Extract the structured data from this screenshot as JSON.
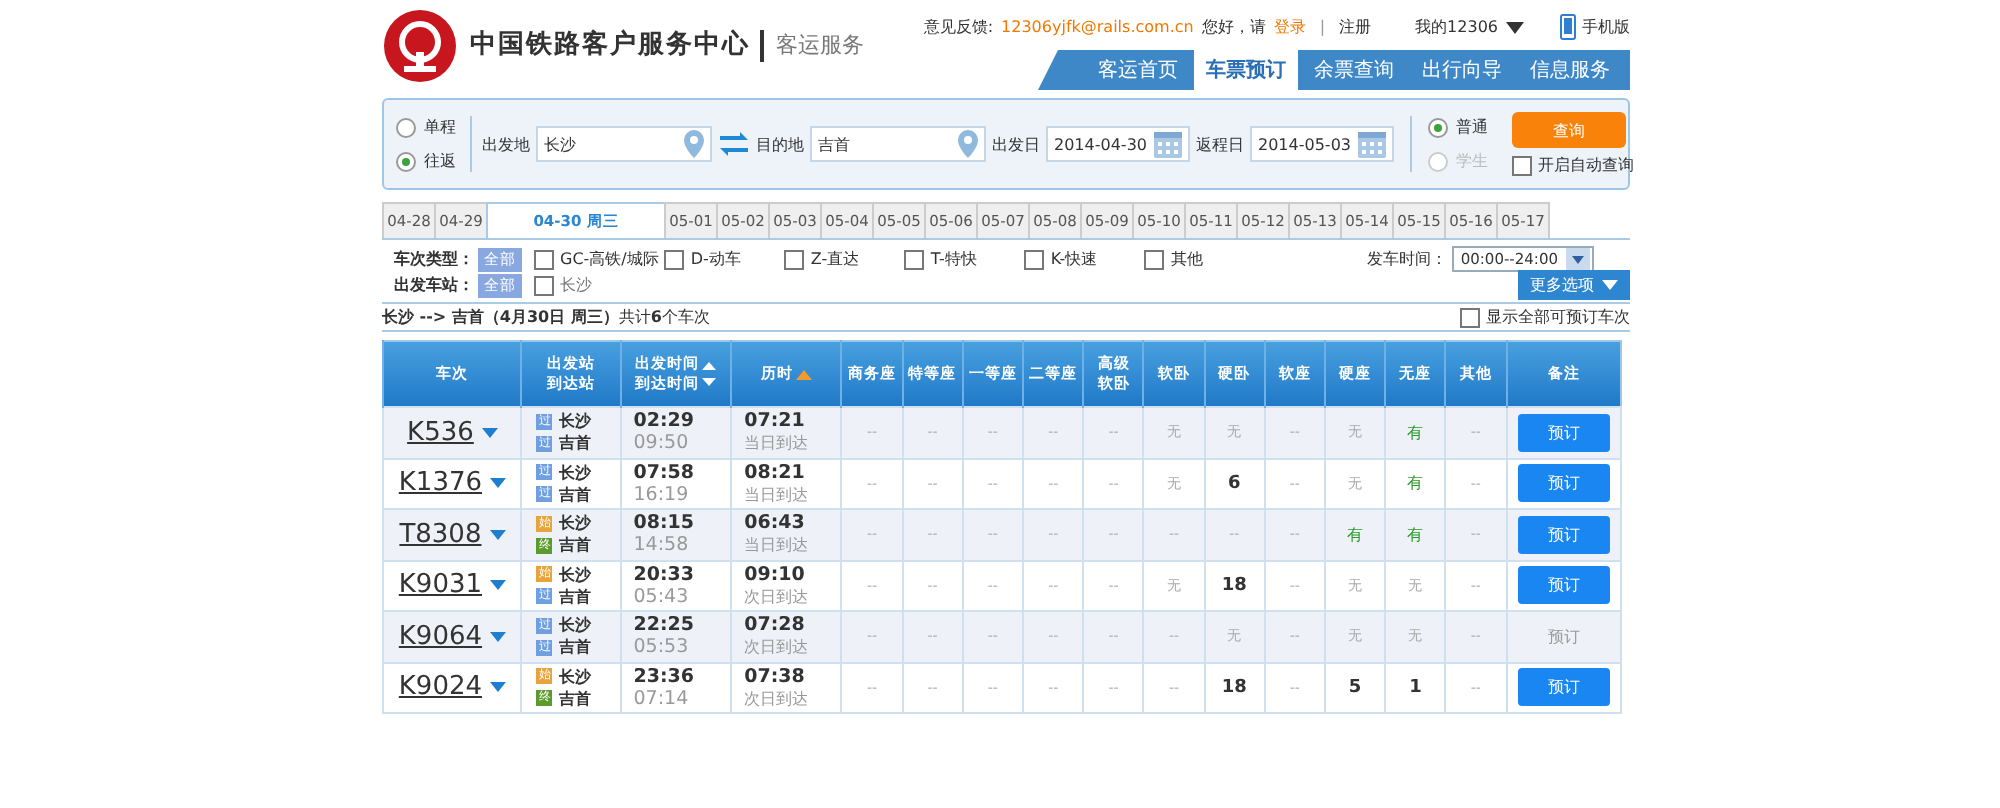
{
  "header": {
    "site_title": "中国铁路客户服务中心",
    "subtitle": "客运服务",
    "feedback_label": "意见反馈:",
    "feedback_email": "12306yjfk@rails.com.cn",
    "greeting": "您好，请",
    "login": "登录",
    "separator": "|",
    "register": "注册",
    "my_account": "我的12306",
    "mobile": "手机版"
  },
  "nav": [
    {
      "label": "客运首页",
      "selected": false
    },
    {
      "label": "车票预订",
      "selected": true
    },
    {
      "label": "余票查询",
      "selected": false
    },
    {
      "label": "出行向导",
      "selected": false
    },
    {
      "label": "信息服务",
      "selected": false
    }
  ],
  "search": {
    "trip_types": [
      {
        "label": "单程",
        "selected": false
      },
      {
        "label": "往返",
        "selected": true
      }
    ],
    "from_label": "出发地",
    "from_value": "长沙",
    "to_label": "目的地",
    "to_value": "吉首",
    "depart_label": "出发日",
    "depart_value": "2014-04-30",
    "return_label": "返程日",
    "return_value": "2014-05-03",
    "passenger_types": [
      {
        "label": "普通",
        "selected": true,
        "disabled": false
      },
      {
        "label": "学生",
        "selected": false,
        "disabled": true
      }
    ],
    "query_button": "查询",
    "auto_query": {
      "label": "开启自动查询",
      "checked": false
    }
  },
  "date_tabs": [
    {
      "label": "04-28",
      "selected": false
    },
    {
      "label": "04-29",
      "selected": false
    },
    {
      "label": "04-30 周三",
      "selected": true
    },
    {
      "label": "05-01",
      "selected": false
    },
    {
      "label": "05-02",
      "selected": false
    },
    {
      "label": "05-03",
      "selected": false
    },
    {
      "label": "05-04",
      "selected": false
    },
    {
      "label": "05-05",
      "selected": false
    },
    {
      "label": "05-06",
      "selected": false
    },
    {
      "label": "05-07",
      "selected": false
    },
    {
      "label": "05-08",
      "selected": false
    },
    {
      "label": "05-09",
      "selected": false
    },
    {
      "label": "05-10",
      "selected": false
    },
    {
      "label": "05-11",
      "selected": false
    },
    {
      "label": "05-12",
      "selected": false
    },
    {
      "label": "05-13",
      "selected": false
    },
    {
      "label": "05-14",
      "selected": false
    },
    {
      "label": "05-15",
      "selected": false
    },
    {
      "label": "05-16",
      "selected": false
    },
    {
      "label": "05-17",
      "selected": false
    }
  ],
  "filters": {
    "type_label": "车次类型：",
    "type_all": "全部",
    "types": [
      {
        "label": "GC-高铁/城际",
        "checked": false
      },
      {
        "label": "D-动车",
        "checked": false
      },
      {
        "label": "Z-直达",
        "checked": false
      },
      {
        "label": "T-特快",
        "checked": false
      },
      {
        "label": "K-快速",
        "checked": false
      },
      {
        "label": "其他",
        "checked": false
      }
    ],
    "time_label": "发车时间：",
    "time_value": "00:00--24:00",
    "station_label": "出发车站：",
    "station_all": "全部",
    "stations": [
      {
        "label": "长沙",
        "checked": false
      }
    ],
    "more_options": "更多选项"
  },
  "summary": "**长沙 --> 吉首（4月30日  周三）**共计**6**个车次",
  "show_all": {
    "label": "显示全部可预订车次",
    "checked": false
  },
  "table": {
    "columns": [
      {
        "label": "车次",
        "kind": "plain"
      },
      {
        "lines": [
          "出发站",
          "到达站"
        ],
        "kind": "plain"
      },
      {
        "lines": [
          "出发时间",
          "到达时间"
        ],
        "kind": "updown"
      },
      {
        "label": "历时",
        "kind": "up"
      },
      {
        "label": "商务座",
        "kind": "plain"
      },
      {
        "label": "特等座",
        "kind": "plain"
      },
      {
        "label": "一等座",
        "kind": "plain"
      },
      {
        "label": "二等座",
        "kind": "plain"
      },
      {
        "lines": [
          "高级",
          "软卧"
        ],
        "kind": "plain"
      },
      {
        "label": "软卧",
        "kind": "plain"
      },
      {
        "label": "硬卧",
        "kind": "plain"
      },
      {
        "label": "软座",
        "kind": "plain"
      },
      {
        "label": "硬座",
        "kind": "plain"
      },
      {
        "label": "无座",
        "kind": "plain"
      },
      {
        "label": "其他",
        "kind": "plain"
      },
      {
        "label": "备注",
        "kind": "plain"
      }
    ],
    "rows": [
      {
        "train": "K536",
        "from": {
          "badge": "过",
          "kind": "pass",
          "name": "长沙"
        },
        "to": {
          "badge": "过",
          "kind": "pass",
          "name": "吉首"
        },
        "depart": "02:29",
        "arrive": "09:50",
        "duration": "07:21",
        "arrival_day": "当日到达",
        "seats": [
          "--",
          "--",
          "--",
          "--",
          "--",
          "无",
          "无",
          "--",
          "无",
          "有",
          "--"
        ],
        "book": {
          "label": "预订",
          "disabled": false
        }
      },
      {
        "train": "K1376",
        "from": {
          "badge": "过",
          "kind": "pass",
          "name": "长沙"
        },
        "to": {
          "badge": "过",
          "kind": "pass",
          "name": "吉首"
        },
        "depart": "07:58",
        "arrive": "16:19",
        "duration": "08:21",
        "arrival_day": "当日到达",
        "seats": [
          "--",
          "--",
          "--",
          "--",
          "--",
          "无",
          "6",
          "--",
          "无",
          "有",
          "--"
        ],
        "book": {
          "label": "预订",
          "disabled": false
        }
      },
      {
        "train": "T8308",
        "from": {
          "badge": "始",
          "kind": "start",
          "name": "长沙"
        },
        "to": {
          "badge": "终",
          "kind": "end",
          "name": "吉首"
        },
        "depart": "08:15",
        "arrive": "14:58",
        "duration": "06:43",
        "arrival_day": "当日到达",
        "seats": [
          "--",
          "--",
          "--",
          "--",
          "--",
          "--",
          "--",
          "--",
          "有",
          "有",
          "--"
        ],
        "book": {
          "label": "预订",
          "disabled": false
        }
      },
      {
        "train": "K9031",
        "from": {
          "badge": "始",
          "kind": "start",
          "name": "长沙"
        },
        "to": {
          "badge": "过",
          "kind": "pass",
          "name": "吉首"
        },
        "depart": "20:33",
        "arrive": "05:43",
        "duration": "09:10",
        "arrival_day": "次日到达",
        "seats": [
          "--",
          "--",
          "--",
          "--",
          "--",
          "无",
          "18",
          "--",
          "无",
          "无",
          "--"
        ],
        "book": {
          "label": "预订",
          "disabled": false
        }
      },
      {
        "train": "K9064",
        "from": {
          "badge": "过",
          "kind": "pass",
          "name": "长沙"
        },
        "to": {
          "badge": "过",
          "kind": "pass",
          "name": "吉首"
        },
        "depart": "22:25",
        "arrive": "05:53",
        "duration": "07:28",
        "arrival_day": "次日到达",
        "seats": [
          "--",
          "--",
          "--",
          "--",
          "--",
          "--",
          "无",
          "--",
          "无",
          "无",
          "--"
        ],
        "book": {
          "label": "预订",
          "disabled": true
        }
      },
      {
        "train": "K9024",
        "from": {
          "badge": "始",
          "kind": "start",
          "name": "长沙"
        },
        "to": {
          "badge": "终",
          "kind": "end",
          "name": "吉首"
        },
        "depart": "23:36",
        "arrive": "07:14",
        "duration": "07:38",
        "arrival_day": "次日到达",
        "seats": [
          "--",
          "--",
          "--",
          "--",
          "--",
          "--",
          "18",
          "--",
          "5",
          "1",
          "--"
        ],
        "book": {
          "label": "预订",
          "disabled": false
        }
      }
    ]
  }
}
